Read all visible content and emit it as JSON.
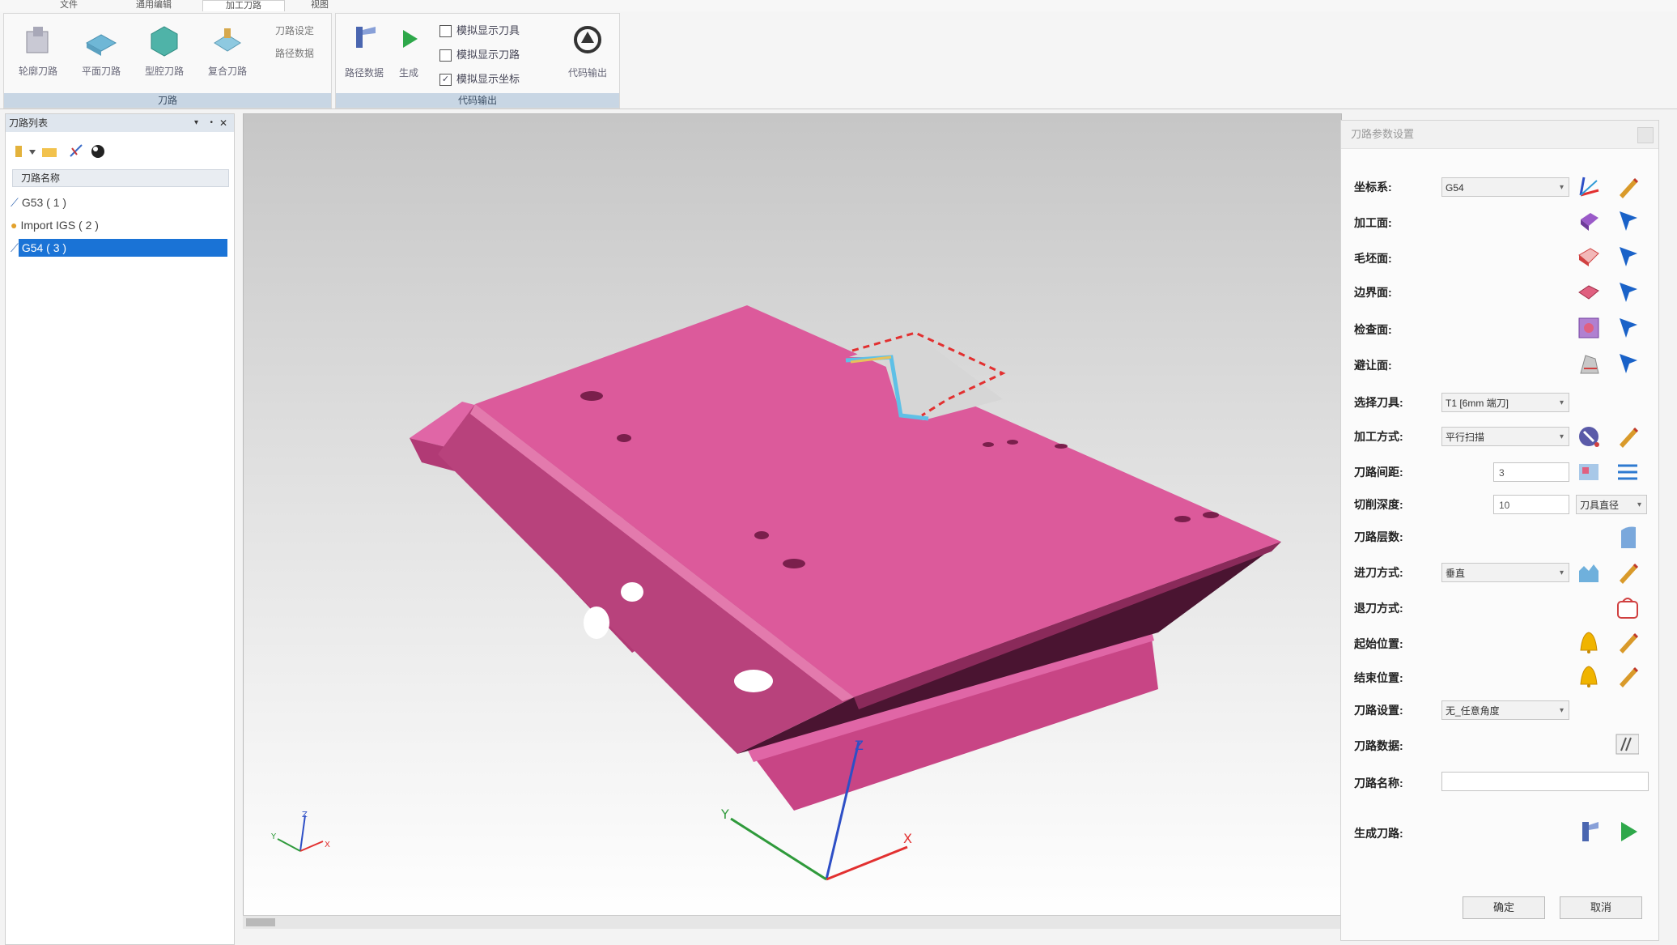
{
  "tabs": [
    {
      "label": "文件"
    },
    {
      "label": "通用编辑"
    },
    {
      "label": "加工刀路"
    },
    {
      "label": "视图"
    }
  ],
  "ribbon": {
    "groups": [
      {
        "title": "刀路"
      },
      {
        "title": "代码输出"
      }
    ],
    "buttons": {
      "b1": "轮廓刀路",
      "b2": "平面刀路",
      "b3": "型腔刀路",
      "b4": "复合刀路",
      "b5": "刀路设定",
      "b6": "路径数据",
      "b7": "生成",
      "b8": "代码输出"
    },
    "checks": [
      {
        "label": "模拟显示刀具",
        "checked": false
      },
      {
        "label": "模拟显示刀路",
        "checked": false
      },
      {
        "label": "模拟显示坐标",
        "checked": true
      }
    ]
  },
  "left_panel": {
    "title": "刀路列表",
    "header": "刀路名称",
    "items": [
      {
        "label": "G53 ( 1 )"
      },
      {
        "label": "Import IGS ( 2 )"
      },
      {
        "label": "G54 ( 3 )",
        "selected": true
      }
    ]
  },
  "viewport": {
    "axes": {
      "x": "X",
      "y": "Y",
      "z": "Z"
    },
    "part_color": "#d9559a",
    "selection_color": "#e23030"
  },
  "dialog": {
    "title": "刀路参数设置",
    "rows": {
      "r1": "坐标系:",
      "r2": "加工面:",
      "r3": "毛坯面:",
      "r4": "边界面:",
      "r5": "检查面:",
      "r6": "避让面:",
      "r7": "选择刀具:",
      "r8": "加工方式:",
      "r9": "刀路间距:",
      "r10": "切削深度:",
      "r11": "刀路层数:",
      "r12": "进刀方式:",
      "r13": "退刀方式:",
      "r14": "起始位置:",
      "r15": "结束位置:",
      "r16": "刀路设置:",
      "r17": "刀路数据:",
      "r18": "刀路名称:",
      "r19": "生成刀路:"
    },
    "values": {
      "coordinate": "G54",
      "tool": "T1 [6mm 端刀]",
      "mode": "平行扫描",
      "spacing": "3",
      "depth": "10",
      "depth_mode": "刀具直径",
      "entry": "垂直",
      "setting": "无_任意角度",
      "name": ""
    },
    "ok": "确定",
    "cancel": "取消"
  }
}
